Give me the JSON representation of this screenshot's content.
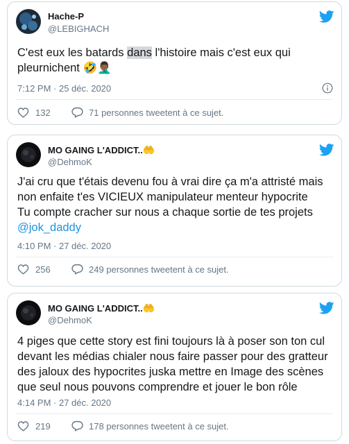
{
  "colors": {
    "accent": "#1da1f2",
    "link": "#1b95e0",
    "muted": "#657786",
    "border": "#cfd9de"
  },
  "tweets": [
    {
      "name": "Hache-P",
      "handle": "@LEBIGHACH",
      "text_before": "C'est eux les batards ",
      "text_highlight": "dans",
      "text_after": " l'histoire mais c'est eux qui",
      "text_line2": "pleurnichent 🤣🤦🏾‍♂️",
      "timestamp": "7:12 PM · 25 déc. 2020",
      "likes": "132",
      "replies": "71 personnes tweetent à ce sujet."
    },
    {
      "name": "MO GAING L'ADDICT..",
      "name_emoji": "🤲",
      "handle": "@DehmoK",
      "lines": [
        "J'ai cru que t'étais devenu fou à vrai dire ça m'a attristé mais",
        "non enfaite t'es VICIEUX manipulateur menteur hypocrite",
        "Tu compte cracher sur nous a chaque sortie de tes projets"
      ],
      "mention": "@jok_daddy",
      "timestamp": "4:10 PM · 27 déc. 2020",
      "likes": "256",
      "replies": "249 personnes tweetent à ce sujet."
    },
    {
      "name": "MO GAING L'ADDICT..",
      "name_emoji": "🤲",
      "handle": "@DehmoK",
      "lines": [
        "4 piges que cette story est fini toujours là à poser son ton cul",
        "devant les médias chialer nous faire passer pour des gratteur",
        "des jaloux des hypocrites juska mettre en Image des scènes",
        "que seul nous pouvons comprendre et jouer le bon rôle"
      ],
      "timestamp": "4:14 PM · 27 déc. 2020",
      "likes": "219",
      "replies": "178 personnes tweetent à ce sujet."
    }
  ]
}
